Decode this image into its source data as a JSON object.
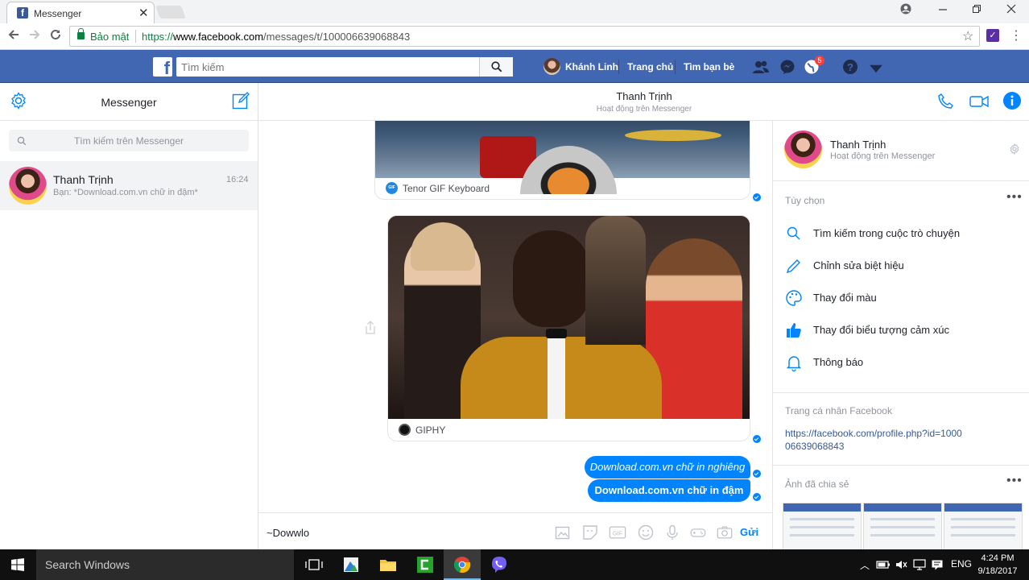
{
  "browser": {
    "tab_title": "Messenger",
    "tab_close": "✕",
    "secure_label": "Bảo mật",
    "url_scheme": "https://",
    "url_host": "www.facebook.com",
    "url_path": "/messages/t/100006639068843"
  },
  "facebook": {
    "logo": "f",
    "search_placeholder": "Tìm kiếm",
    "profile_name": "Khánh Linh",
    "nav_home": "Trang chủ",
    "nav_find_friends": "Tìm bạn bè",
    "notification_count": "5"
  },
  "sidebar": {
    "title": "Messenger",
    "search_placeholder": "Tìm kiếm trên Messenger",
    "conversations": [
      {
        "name": "Thanh Trịnh",
        "time": "16:24",
        "preview": "Bạn: *Download.com.vn chữ in đậm*"
      }
    ]
  },
  "conversation": {
    "name": "Thanh Trịnh",
    "status": "Hoạt động trên Messenger",
    "messages": [
      {
        "type": "gif",
        "source": "Tenor GIF Keyboard",
        "source_icon": "GIF"
      },
      {
        "type": "gif",
        "source": "GIPHY"
      },
      {
        "type": "text",
        "text": "Download.com.vn chữ in nghiêng",
        "style": "italic"
      },
      {
        "type": "text",
        "text": "Download.com.vn chữ in đậm",
        "style": "bold"
      }
    ],
    "composer_value": "~Dowwlo",
    "send_label": "Gửi"
  },
  "info_panel": {
    "name": "Thanh Trịnh",
    "status": "Hoạt động trên Messenger",
    "options_title": "Tùy chọn",
    "more": "•••",
    "options": [
      {
        "label": "Tìm kiếm trong cuộc trò chuyện",
        "icon": "search-icon"
      },
      {
        "label": "Chỉnh sửa biệt hiệu",
        "icon": "pencil-icon"
      },
      {
        "label": "Thay đổi màu",
        "icon": "palette-icon"
      },
      {
        "label": "Thay đổi biểu tượng cảm xúc",
        "icon": "thumbs-up-icon"
      },
      {
        "label": "Thông báo",
        "icon": "bell-icon"
      }
    ],
    "profile_title": "Trang cá nhân Facebook",
    "profile_link": "https://facebook.com/profile.php?id=100006639068843",
    "shared_photos_title": "Ảnh đã chia sẻ"
  },
  "taskbar": {
    "search_placeholder": "Search Windows",
    "language": "ENG",
    "time": "4:24 PM",
    "date": "9/18/2017"
  },
  "colors": {
    "facebook_blue": "#4267b2",
    "messenger_blue": "#0084ff"
  }
}
